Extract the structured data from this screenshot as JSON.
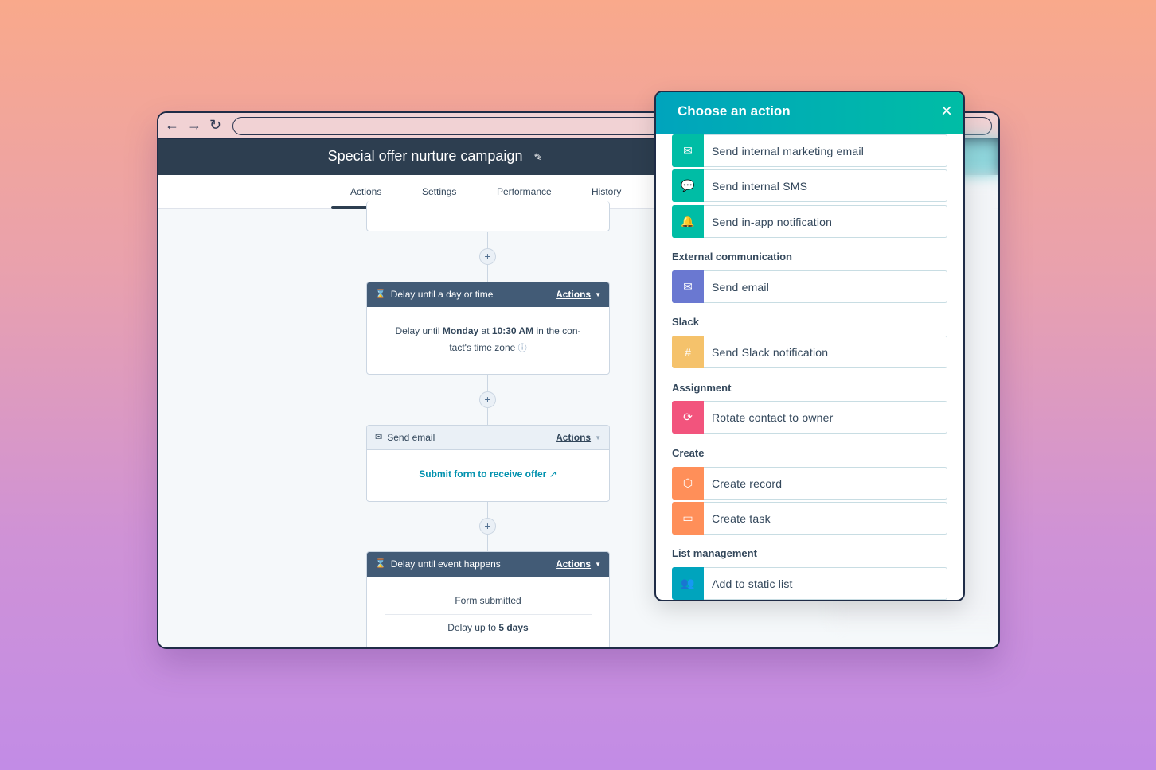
{
  "browser": {
    "back_icon": "←",
    "forward_icon": "→",
    "reload_icon": "↻"
  },
  "workflow": {
    "title": "Special offer nurture campaign",
    "edit_icon": "✎",
    "tabs": [
      {
        "label": "Actions",
        "active": true
      },
      {
        "label": "Settings"
      },
      {
        "label": "Performance"
      },
      {
        "label": "History"
      }
    ],
    "cards": [
      {
        "type": "Delay until a day or time",
        "actions": "Actions",
        "body_pre": "Delay until ",
        "day": "Monday",
        "mid": " at ",
        "time": "10:30 AM",
        "post": " in the con-",
        "line2": "tact's time zone"
      },
      {
        "type": "Send email",
        "actions": "Actions",
        "link": "Submit form to receive offer"
      },
      {
        "type": "Delay until event happens",
        "actions": "Actions",
        "event": "Form submitted",
        "delay_pre": "Delay up to ",
        "delay_val": "5 days"
      }
    ]
  },
  "panel": {
    "title": "Choose an action",
    "close_icon": "×",
    "items": [
      {
        "label": "Send internal marketing email",
        "icon": "envelope-icon",
        "color": "#00bda5"
      },
      {
        "label": "Send internal SMS",
        "icon": "chat-icon",
        "color": "#00bda5"
      },
      {
        "label": "Send in-app notification",
        "icon": "bell-icon",
        "color": "#00bda5"
      },
      {
        "label": "Send email",
        "icon": "envelope-icon",
        "color": "#6a78d1"
      },
      {
        "label": "Send Slack notification",
        "icon": "slack-icon",
        "color": "#f5c26b"
      },
      {
        "label": "Rotate contact to owner",
        "icon": "rotate-icon",
        "color": "#f2547d"
      },
      {
        "label": "Create record",
        "icon": "cube-icon",
        "color": "#ff8f59"
      },
      {
        "label": "Create task",
        "icon": "task-icon",
        "color": "#ff8f59"
      },
      {
        "label": "Add to static list",
        "icon": "people-icon",
        "color": "#00a4bd"
      }
    ],
    "sections": [
      "External communication",
      "Slack",
      "Assignment",
      "Create",
      "List management"
    ]
  }
}
